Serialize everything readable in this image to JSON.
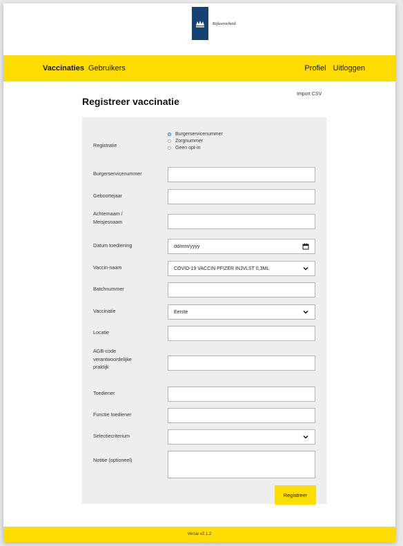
{
  "header": {
    "brand": "Rijksoverheid"
  },
  "nav": {
    "left": [
      "Vaccinaties",
      "Gebruikers"
    ],
    "right": [
      "Profiel",
      "Uitloggen"
    ],
    "active": "Vaccinaties"
  },
  "page": {
    "title": "Registreer vaccinatie",
    "import_link": "Import CSV"
  },
  "form": {
    "registratie": {
      "label": "Registratie",
      "options": [
        "Burgerservicenummer",
        "Zorgnummer",
        "Geen opt-in"
      ],
      "selected": "Burgerservicenummer"
    },
    "burgerservicenummer": {
      "label": "Burgerservicenummer",
      "value": ""
    },
    "geboortejaar": {
      "label": "Geboortejaar",
      "value": ""
    },
    "achternaam": {
      "label_line1": "Achternaam /",
      "label_line2": "Meisjesnaam",
      "value": ""
    },
    "datum": {
      "label": "Datum toediening",
      "placeholder": "dd/mm/yyyy"
    },
    "vaccin": {
      "label": "Vaccin-naam",
      "value": "COVID-19 VACCIN PFIZER INJVLST 0,3ML"
    },
    "batch": {
      "label": "Batchnummer",
      "value": ""
    },
    "vaccinatie": {
      "label": "Vaccinatie",
      "value": "Eerste"
    },
    "locatie": {
      "label": "Locatie",
      "value": ""
    },
    "agb": {
      "label_line1": "AGB-code",
      "label_line2": "verantwoordelijke",
      "label_line3": "praktijk",
      "value": ""
    },
    "toediener": {
      "label": "Toediener",
      "value": ""
    },
    "functie": {
      "label": "Functie toediener",
      "value": ""
    },
    "selectiecriterium": {
      "label": "Selectiecriterium",
      "value": ""
    },
    "notitie": {
      "label": "Notitie (optioneel)",
      "value": ""
    },
    "submit_label": "Registreer"
  },
  "footer": {
    "version": "Versie v2.1.2"
  },
  "colors": {
    "accent": "#ffdd00",
    "logo": "#154273",
    "panel": "#eeeeee"
  }
}
